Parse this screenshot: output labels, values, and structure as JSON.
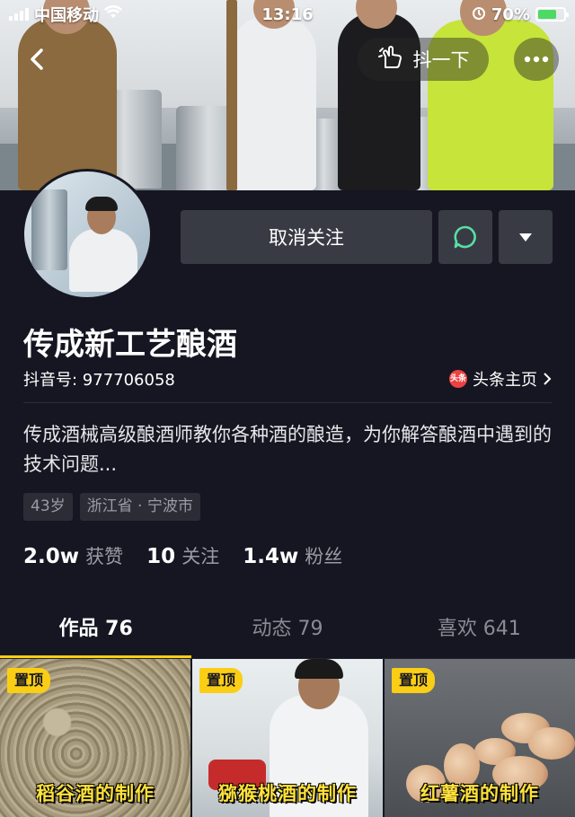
{
  "status_bar": {
    "carrier": "中国移动",
    "time": "13:16",
    "battery": "70%",
    "battery_level": 0.7
  },
  "header": {
    "shake_label": "抖一下"
  },
  "profile": {
    "unfollow_label": "取消关注",
    "nickname": "传成新工艺酿酒",
    "douyin_id": "抖音号: 977706058",
    "toutiao_label": "头条主页",
    "toutiao_logo": "头条",
    "bio": "传成酒械高级酿酒师教你各种酒的酿造，为你解答酿酒中遇到的技术问题...",
    "tags": [
      "43岁",
      "浙江省 · 宁波市"
    ],
    "stats": [
      {
        "num": "2.0w",
        "label": "获赞"
      },
      {
        "num": "10",
        "label": "关注"
      },
      {
        "num": "1.4w",
        "label": "粉丝"
      }
    ]
  },
  "tabs": [
    {
      "label": "作品 76",
      "active": true
    },
    {
      "label": "动态 79",
      "active": false
    },
    {
      "label": "喜欢 641",
      "active": false
    }
  ],
  "videos": [
    {
      "pin": "置顶",
      "caption": "稻谷酒的制作"
    },
    {
      "pin": "置顶",
      "caption": "猕猴桃酒的制作"
    },
    {
      "pin": "置顶",
      "caption": "红薯酒的制作"
    }
  ],
  "colors": {
    "background": "#161622",
    "button": "#393b44",
    "accent": "#face15",
    "chat_icon": "#56e0a6",
    "toutiao_red": "#f04142"
  },
  "icons": {
    "back": "chevron-left-icon",
    "shake": "hand-shake-icon",
    "more": "more-dots-icon",
    "chat": "chat-bubble-icon",
    "dropdown": "triangle-down-icon",
    "toutiao_arrow": "chevron-right-icon"
  }
}
